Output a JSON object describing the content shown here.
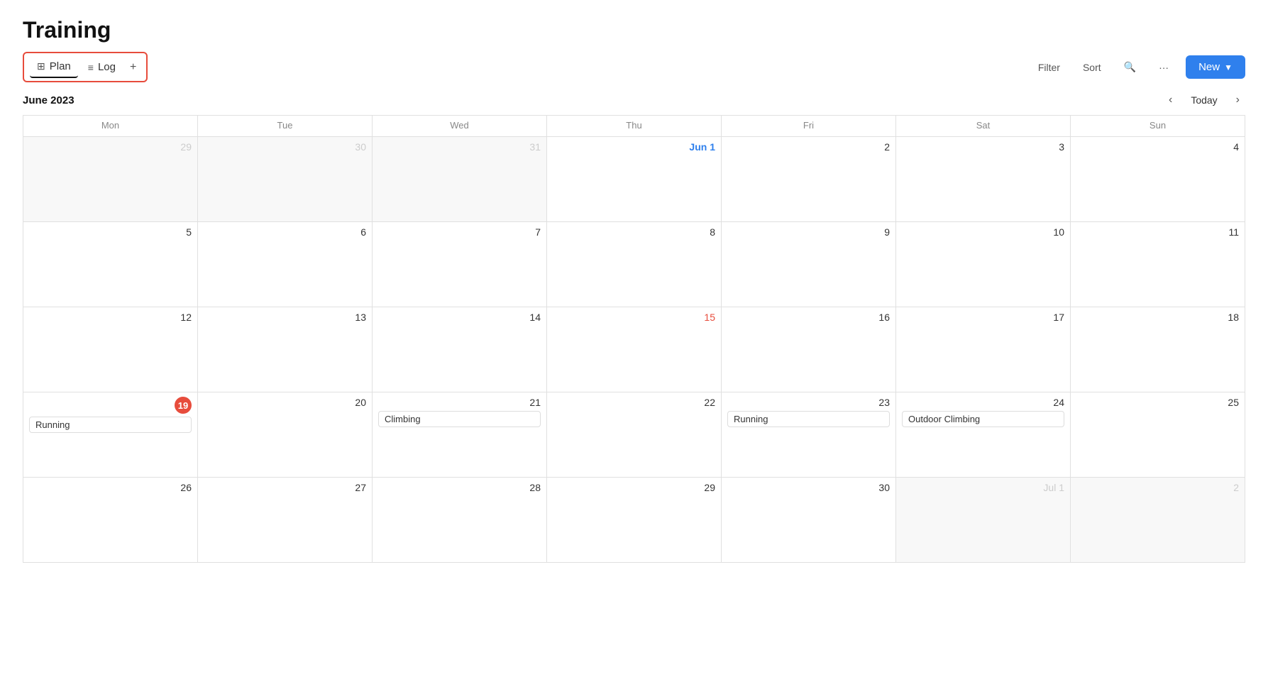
{
  "page": {
    "title": "Training"
  },
  "tabs": [
    {
      "id": "plan",
      "label": "Plan",
      "icon": "📅",
      "active": true
    },
    {
      "id": "log",
      "label": "Log",
      "icon": "📋",
      "active": false
    }
  ],
  "toolbar": {
    "filter_label": "Filter",
    "sort_label": "Sort",
    "more_label": "···",
    "new_label": "New"
  },
  "calendar": {
    "month_label": "June 2023",
    "today_label": "Today",
    "days_of_week": [
      "Mon",
      "Tue",
      "Wed",
      "Thu",
      "Fri",
      "Sat",
      "Sun"
    ],
    "weeks": [
      {
        "days": [
          {
            "number": "29",
            "type": "other",
            "events": []
          },
          {
            "number": "30",
            "type": "other",
            "events": []
          },
          {
            "number": "31",
            "type": "other",
            "events": []
          },
          {
            "number": "Jun 1",
            "type": "first",
            "events": []
          },
          {
            "number": "2",
            "type": "current",
            "events": []
          },
          {
            "number": "3",
            "type": "current",
            "events": []
          },
          {
            "number": "4",
            "type": "current",
            "events": []
          }
        ]
      },
      {
        "days": [
          {
            "number": "5",
            "type": "current",
            "events": []
          },
          {
            "number": "6",
            "type": "current",
            "events": []
          },
          {
            "number": "7",
            "type": "current",
            "events": []
          },
          {
            "number": "8",
            "type": "current",
            "events": []
          },
          {
            "number": "9",
            "type": "current",
            "events": []
          },
          {
            "number": "10",
            "type": "current",
            "events": []
          },
          {
            "number": "11",
            "type": "current",
            "events": []
          }
        ]
      },
      {
        "days": [
          {
            "number": "12",
            "type": "current",
            "events": []
          },
          {
            "number": "13",
            "type": "current",
            "events": []
          },
          {
            "number": "14",
            "type": "current",
            "events": []
          },
          {
            "number": "15",
            "type": "red",
            "events": []
          },
          {
            "number": "16",
            "type": "current",
            "events": []
          },
          {
            "number": "17",
            "type": "current",
            "events": []
          },
          {
            "number": "18",
            "type": "current",
            "events": []
          }
        ]
      },
      {
        "days": [
          {
            "number": "19",
            "type": "today",
            "events": [
              "Running"
            ]
          },
          {
            "number": "20",
            "type": "current",
            "events": []
          },
          {
            "number": "21",
            "type": "current",
            "events": [
              "Climbing"
            ]
          },
          {
            "number": "22",
            "type": "current",
            "events": []
          },
          {
            "number": "23",
            "type": "current",
            "events": [
              "Running"
            ]
          },
          {
            "number": "24",
            "type": "current",
            "events": [
              "Outdoor Climbing"
            ]
          },
          {
            "number": "25",
            "type": "current",
            "events": []
          }
        ]
      },
      {
        "days": [
          {
            "number": "26",
            "type": "current",
            "events": []
          },
          {
            "number": "27",
            "type": "current",
            "events": []
          },
          {
            "number": "28",
            "type": "current",
            "events": []
          },
          {
            "number": "29",
            "type": "current",
            "events": []
          },
          {
            "number": "30",
            "type": "current",
            "events": []
          },
          {
            "number": "Jul 1",
            "type": "other-end",
            "events": []
          },
          {
            "number": "2",
            "type": "other-end",
            "events": []
          }
        ]
      }
    ]
  }
}
